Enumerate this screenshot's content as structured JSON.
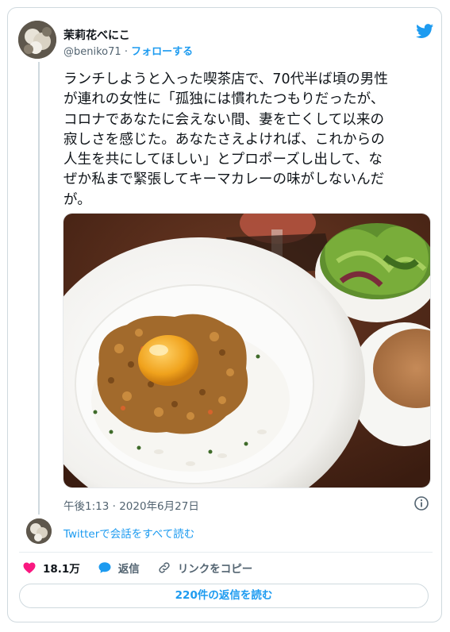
{
  "author": {
    "display_name": "茉莉花べにこ",
    "handle": "@beniko71",
    "separator": "·",
    "follow_label": "フォローする"
  },
  "tweet": {
    "text_lines": [
      "ランチしようと入った喫茶店で、70代半ば頃の男性",
      "が連れの女性に「孤独には慣れたつもりだったが、",
      "コロナであなたに会えない間、妻を亡くして以来の",
      "寂しさを感じた。あなたさえよければ、これからの",
      "人生を共にしてほしい」とプロポーズし出して、な",
      "ぜか私まで緊張してキーマカレーの味がしないんだ",
      "が。"
    ],
    "timestamp": "午後1:13 · 2020年6月27日"
  },
  "photo": {
    "icon": "food-photo-keema-curry",
    "subject": "keema curry with egg yolk on rice, salad, soup"
  },
  "conversation": {
    "read_all_label": "Twitterで会話をすべて読む"
  },
  "actions": {
    "like_count": "18.1万",
    "reply_label": "返信",
    "copy_link_label": "リンクをコピー"
  },
  "replies_button": "220件の返信を読む",
  "colors": {
    "accent": "#1d9bf0",
    "like": "#f91880",
    "muted": "#536471",
    "border": "#cfd9de"
  }
}
